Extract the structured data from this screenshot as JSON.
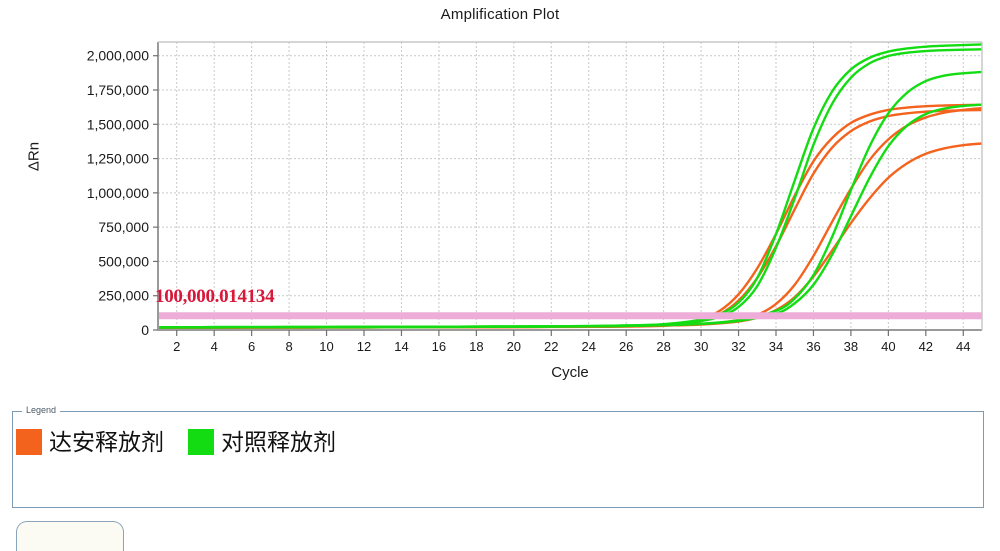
{
  "chart": {
    "title": "Amplification Plot",
    "y_axis_title": "ΔRn",
    "x_axis_title": "Cycle",
    "threshold_label": "100,000.014134"
  },
  "legend": {
    "caption": "Legend",
    "items": [
      {
        "label": "达安释放剂",
        "color": "#F4631E"
      },
      {
        "label": "对照释放剂",
        "color": "#13DC13"
      }
    ]
  },
  "chart_data": {
    "type": "line",
    "title": "Amplification Plot",
    "xlabel": "Cycle",
    "ylabel": "ΔRn",
    "xlim": [
      1,
      45
    ],
    "ylim": [
      0,
      2100000
    ],
    "grid": true,
    "legend_position": "below-plot",
    "xticks": [
      2,
      4,
      6,
      8,
      10,
      12,
      14,
      16,
      18,
      20,
      22,
      24,
      26,
      28,
      30,
      32,
      34,
      36,
      38,
      40,
      42,
      44
    ],
    "yticks": [
      0,
      250000,
      500000,
      750000,
      1000000,
      1250000,
      1500000,
      1750000,
      2000000
    ],
    "ytick_labels": [
      "0",
      "250,000",
      "500,000",
      "750,000",
      "1,000,000",
      "1,250,000",
      "1,500,000",
      "1,750,000",
      "2,000,000"
    ],
    "threshold": {
      "value": 100000.014134,
      "label": "100,000.014134",
      "color": "#EDADD8",
      "label_color": "#D8173A"
    },
    "series": [
      {
        "name": "达安释放剂",
        "color": "#F4631E",
        "ct": 31.6,
        "plateau": 1640000,
        "baseline": 22000,
        "steepness": 0.72,
        "x": [
          1,
          2,
          4,
          6,
          8,
          10,
          12,
          14,
          16,
          18,
          20,
          22,
          24,
          26,
          28,
          29,
          30,
          31,
          32,
          33,
          34,
          35,
          36,
          37,
          38,
          39,
          40,
          41,
          42,
          43,
          44,
          45
        ],
        "y": [
          18000,
          18500,
          19000,
          19500,
          20000,
          20500,
          21000,
          21500,
          22000,
          22500,
          23000,
          24000,
          25000,
          27000,
          35000,
          50000,
          78000,
          140000,
          260000,
          450000,
          700000,
          980000,
          1230000,
          1400000,
          1510000,
          1570000,
          1605000,
          1622000,
          1632000,
          1637000,
          1640000,
          1642000
        ]
      },
      {
        "name": "达安释放剂",
        "color": "#F4631E",
        "ct": 32.1,
        "plateau": 1600000,
        "baseline": 20000,
        "steepness": 0.7,
        "x": [
          1,
          2,
          4,
          6,
          8,
          10,
          12,
          14,
          16,
          18,
          20,
          22,
          24,
          26,
          28,
          29,
          30,
          31,
          32,
          33,
          34,
          35,
          36,
          37,
          38,
          39,
          40,
          41,
          42,
          43,
          44,
          45
        ],
        "y": [
          16000,
          16500,
          17000,
          17500,
          18000,
          18500,
          19000,
          19500,
          20000,
          20500,
          21000,
          22000,
          23000,
          25000,
          31000,
          43000,
          66000,
          115000,
          215000,
          380000,
          610000,
          880000,
          1140000,
          1330000,
          1450000,
          1520000,
          1560000,
          1580000,
          1592000,
          1598000,
          1602000,
          1604000
        ]
      },
      {
        "name": "达安释放剂",
        "color": "#F4631E",
        "ct": 36.0,
        "plateau": 1620000,
        "baseline": 20000,
        "steepness": 0.66,
        "x": [
          1,
          2,
          4,
          6,
          8,
          10,
          12,
          14,
          16,
          18,
          20,
          22,
          24,
          26,
          28,
          30,
          32,
          33,
          34,
          35,
          36,
          37,
          38,
          39,
          40,
          41,
          42,
          43,
          44,
          45
        ],
        "y": [
          16000,
          16500,
          17000,
          17500,
          18000,
          18500,
          19000,
          19500,
          20000,
          21000,
          22000,
          23000,
          25000,
          28000,
          33000,
          42000,
          72000,
          110000,
          190000,
          330000,
          540000,
          790000,
          1030000,
          1240000,
          1390000,
          1490000,
          1550000,
          1585000,
          1605000,
          1618000
        ]
      },
      {
        "name": "达安释放剂",
        "color": "#F4631E",
        "ct": 36.8,
        "plateau": 1360000,
        "baseline": 20000,
        "steepness": 0.62,
        "x": [
          1,
          2,
          4,
          6,
          8,
          10,
          12,
          14,
          16,
          18,
          20,
          22,
          24,
          26,
          28,
          30,
          32,
          33,
          34,
          35,
          36,
          37,
          38,
          39,
          40,
          41,
          42,
          43,
          44,
          45
        ],
        "y": [
          16000,
          16500,
          17000,
          17500,
          18000,
          18500,
          19000,
          19500,
          20000,
          21000,
          22000,
          23000,
          25000,
          28000,
          33000,
          40000,
          62000,
          90000,
          145000,
          240000,
          390000,
          580000,
          780000,
          960000,
          1110000,
          1215000,
          1285000,
          1325000,
          1348000,
          1360000
        ]
      },
      {
        "name": "对照释放剂",
        "color": "#13DC13",
        "ct": 32.6,
        "plateau": 2080000,
        "baseline": 24000,
        "steepness": 0.86,
        "x": [
          1,
          2,
          4,
          6,
          8,
          10,
          12,
          14,
          16,
          18,
          20,
          22,
          24,
          26,
          28,
          30,
          31,
          32,
          33,
          34,
          35,
          36,
          37,
          38,
          39,
          40,
          41,
          42,
          43,
          44,
          45
        ],
        "y": [
          20000,
          20500,
          21000,
          21500,
          22000,
          22500,
          23000,
          23500,
          24000,
          25000,
          26000,
          27000,
          29000,
          33000,
          42000,
          75000,
          115000,
          200000,
          380000,
          700000,
          1090000,
          1470000,
          1740000,
          1900000,
          1985000,
          2030000,
          2053000,
          2066000,
          2073000,
          2078000,
          2082000
        ]
      },
      {
        "name": "对照释放剂",
        "color": "#13DC13",
        "ct": 33.0,
        "plateau": 2040000,
        "baseline": 24000,
        "steepness": 0.84,
        "x": [
          1,
          2,
          4,
          6,
          8,
          10,
          12,
          14,
          16,
          18,
          20,
          22,
          24,
          26,
          28,
          30,
          31,
          32,
          33,
          34,
          35,
          36,
          37,
          38,
          39,
          40,
          41,
          42,
          43,
          44,
          45
        ],
        "y": [
          20000,
          20500,
          21000,
          21500,
          22000,
          22500,
          23000,
          23500,
          24000,
          25000,
          26000,
          27000,
          29000,
          33000,
          40000,
          66000,
          98000,
          168000,
          320000,
          600000,
          960000,
          1350000,
          1650000,
          1840000,
          1945000,
          1998000,
          2022000,
          2034000,
          2040000,
          2044000,
          2047000
        ]
      },
      {
        "name": "对照释放剂",
        "color": "#13DC13",
        "ct": 37.4,
        "plateau": 1880000,
        "baseline": 22000,
        "steepness": 0.8,
        "x": [
          1,
          2,
          4,
          6,
          8,
          10,
          12,
          14,
          16,
          18,
          20,
          22,
          24,
          26,
          28,
          30,
          32,
          34,
          35,
          36,
          37,
          38,
          39,
          40,
          41,
          42,
          43,
          44,
          45
        ],
        "y": [
          18000,
          18500,
          19000,
          19500,
          20000,
          20500,
          21000,
          21500,
          22000,
          23000,
          24000,
          25000,
          27000,
          30000,
          36000,
          46000,
          72000,
          140000,
          230000,
          400000,
          680000,
          1020000,
          1340000,
          1580000,
          1730000,
          1815000,
          1855000,
          1872000,
          1882000
        ]
      },
      {
        "name": "对照释放剂",
        "color": "#13DC13",
        "ct": 37.9,
        "plateau": 1640000,
        "baseline": 22000,
        "steepness": 0.78,
        "x": [
          1,
          2,
          4,
          6,
          8,
          10,
          12,
          14,
          16,
          18,
          20,
          22,
          24,
          26,
          28,
          30,
          32,
          34,
          35,
          36,
          37,
          38,
          39,
          40,
          41,
          42,
          43,
          44,
          45
        ],
        "y": [
          18000,
          18500,
          19000,
          19500,
          20000,
          20500,
          21000,
          21500,
          22000,
          23000,
          24000,
          25000,
          27000,
          30000,
          35000,
          44000,
          66000,
          120000,
          195000,
          330000,
          550000,
          830000,
          1110000,
          1340000,
          1490000,
          1575000,
          1615000,
          1634000,
          1644000
        ]
      }
    ]
  }
}
